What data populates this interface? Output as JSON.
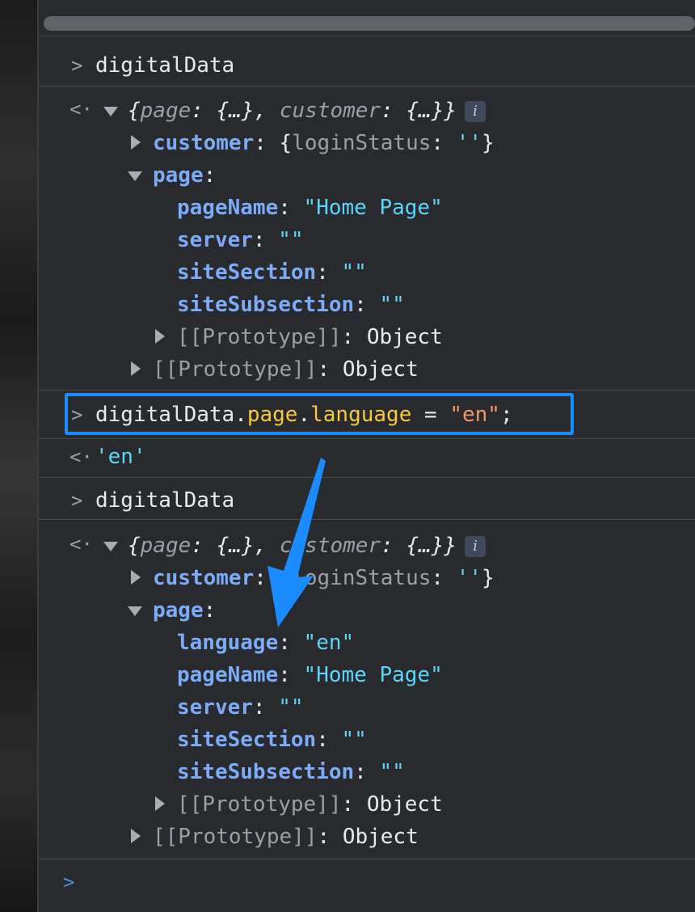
{
  "prompt_glyph": ">",
  "result_glyph": "<·",
  "block1": {
    "input": "digitalData",
    "summary": {
      "open": "{",
      "k1": "page",
      "mid1": ": {…}, ",
      "k2": "customer",
      "mid2": ": {…}}"
    },
    "info_badge": "i",
    "customer": {
      "key": "customer",
      "colon": ": ",
      "open": "{",
      "inner_key": "loginStatus",
      "inner_colon": ": ",
      "inner_val": "''",
      "close": "}"
    },
    "page": {
      "key": "page",
      "colon": ":"
    },
    "fields": [
      {
        "key": "pageName",
        "colon": ": ",
        "value": "\"Home Page\""
      },
      {
        "key": "server",
        "colon": ": ",
        "value": "\"\""
      },
      {
        "key": "siteSection",
        "colon": ": ",
        "value": "\"\""
      },
      {
        "key": "siteSubsection",
        "colon": ": ",
        "value": "\"\""
      }
    ],
    "proto_inner": {
      "label": "[[Prototype]]",
      "colon": ": ",
      "value": "Object"
    },
    "proto_outer": {
      "label": "[[Prototype]]",
      "colon": ": ",
      "value": "Object"
    }
  },
  "command": {
    "obj": "digitalData",
    "dot1": ".",
    "prop1": "page",
    "dot2": ".",
    "prop2": "language",
    "assign": " = ",
    "value": "\"en\"",
    "semi": ";"
  },
  "command_result": "'en'",
  "block2": {
    "input": "digitalData",
    "summary": {
      "open": "{",
      "k1": "page",
      "mid1": ": {…}, ",
      "k2": "customer",
      "mid2": ": {…}}"
    },
    "info_badge": "i",
    "customer": {
      "key": "customer",
      "colon": ": ",
      "open": "{",
      "inner_key": "loginStatus",
      "inner_colon": ": ",
      "inner_val": "''",
      "close": "}"
    },
    "page": {
      "key": "page",
      "colon": ":"
    },
    "fields": [
      {
        "key": "language",
        "colon": ": ",
        "value": "\"en\""
      },
      {
        "key": "pageName",
        "colon": ": ",
        "value": "\"Home Page\""
      },
      {
        "key": "server",
        "colon": ": ",
        "value": "\"\""
      },
      {
        "key": "siteSection",
        "colon": ": ",
        "value": "\"\""
      },
      {
        "key": "siteSubsection",
        "colon": ": ",
        "value": "\"\""
      }
    ],
    "proto_inner": {
      "label": "[[Prototype]]",
      "colon": ": ",
      "value": "Object"
    },
    "proto_outer": {
      "label": "[[Prototype]]",
      "colon": ": ",
      "value": "Object"
    }
  },
  "colors": {
    "highlight_box": "#1a8cff",
    "annotation_arrow": "#1a8cff",
    "key": "#7cacf8",
    "string": "#5cd5fb",
    "assigned_value": "#f29766",
    "property": "#f5c842"
  },
  "annotation": {
    "type": "arrow",
    "from": "command",
    "to": "block2.fields.0"
  }
}
